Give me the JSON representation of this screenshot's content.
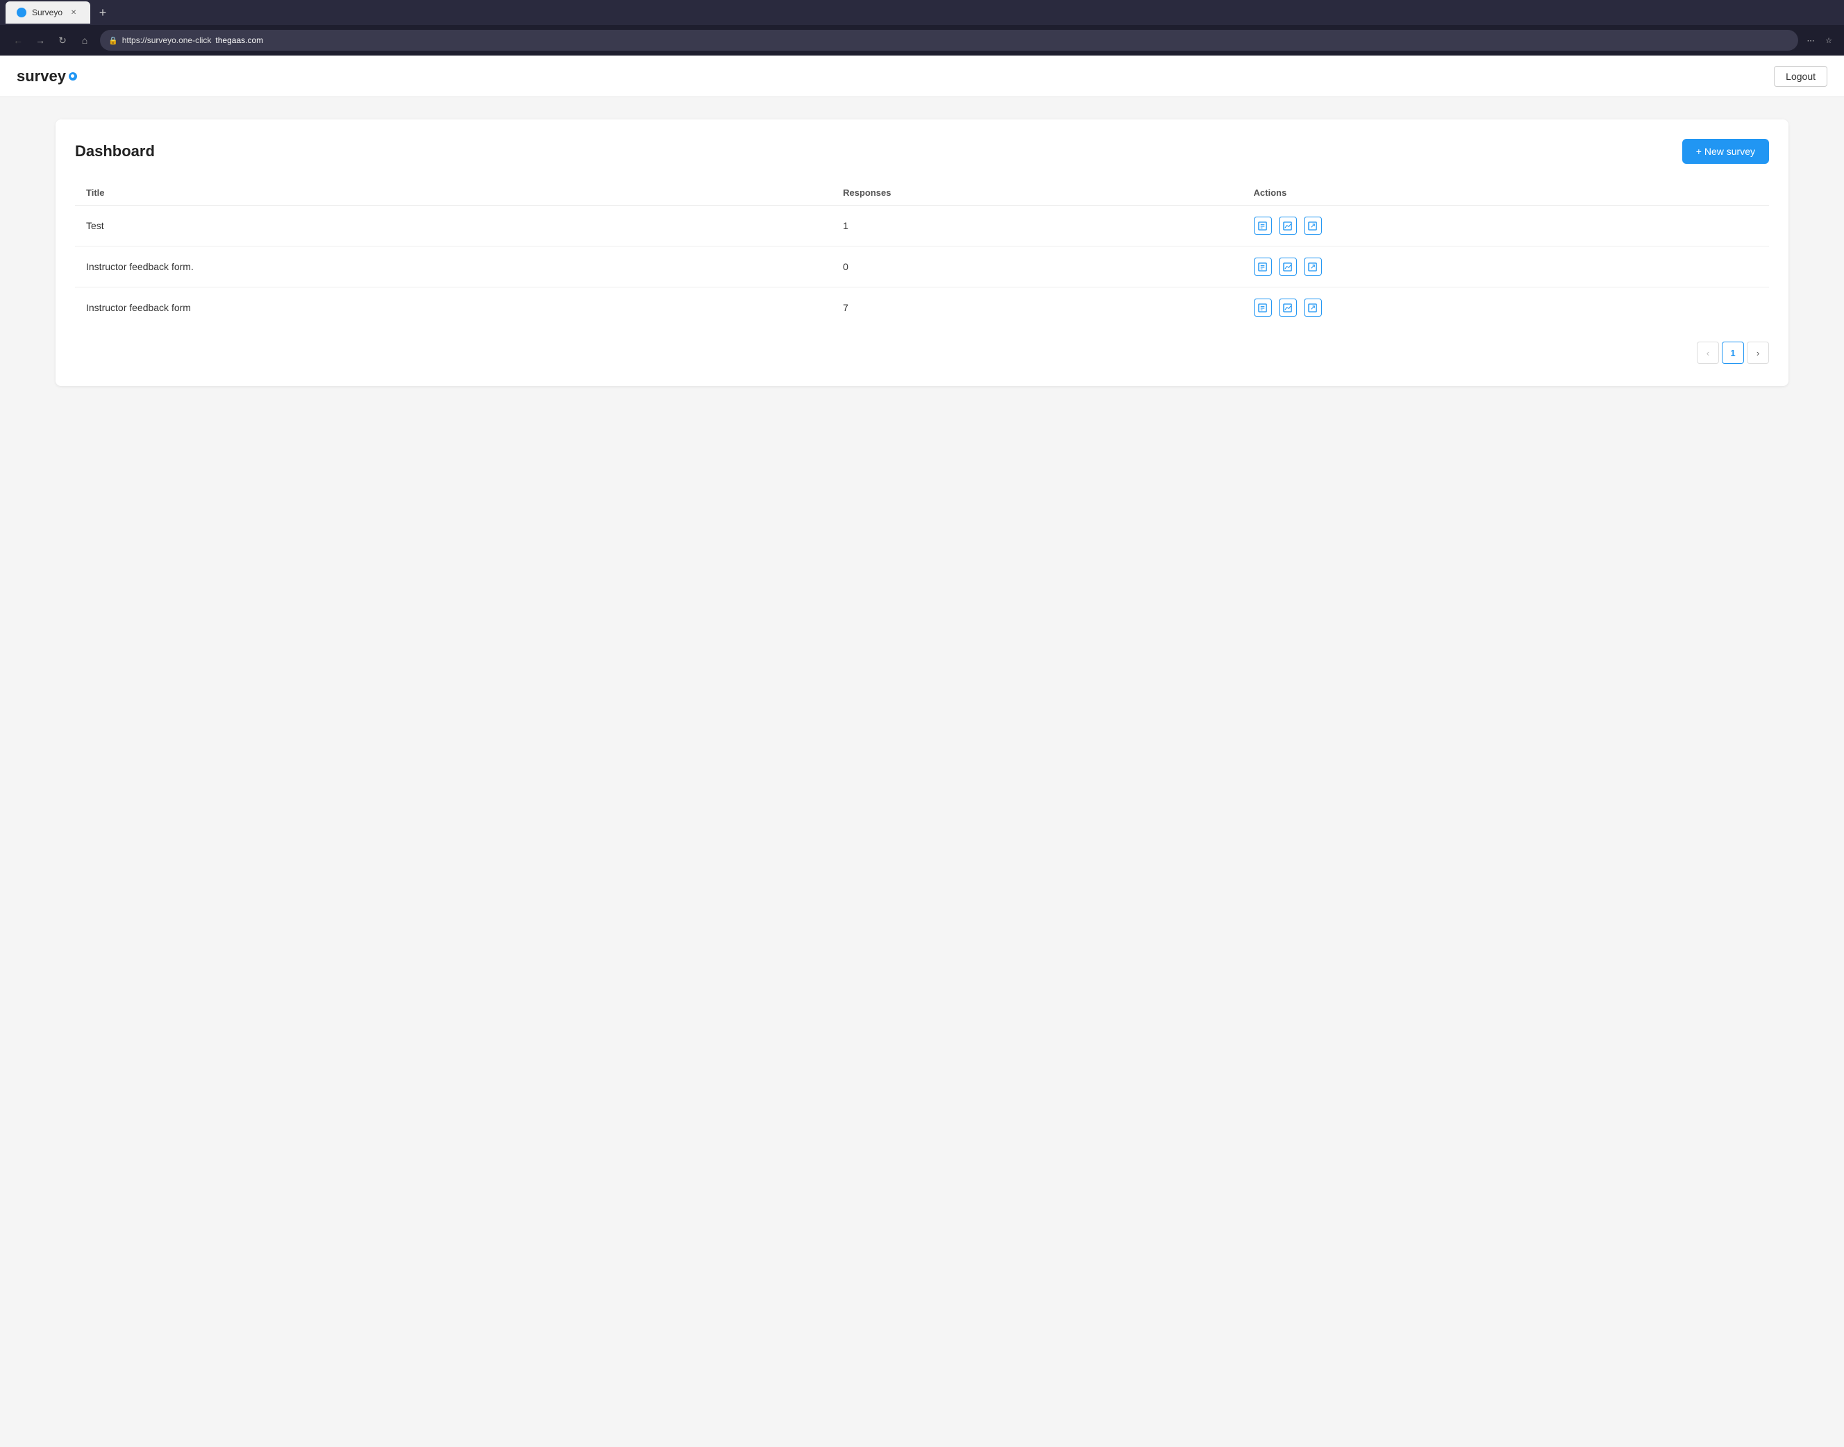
{
  "browser": {
    "tab_title": "Surveyo",
    "tab_favicon": "S",
    "url_prefix": "https://surveyo.one-click",
    "url_domain": "thegaas.com",
    "new_tab_icon": "+"
  },
  "header": {
    "logo_text": "survey",
    "logout_label": "Logout"
  },
  "dashboard": {
    "title": "Dashboard",
    "new_survey_label": "+ New survey",
    "table": {
      "columns": [
        "Title",
        "Responses",
        "Actions"
      ],
      "rows": [
        {
          "title": "Test",
          "responses": "1"
        },
        {
          "title": "Instructor feedback form.",
          "responses": "0"
        },
        {
          "title": "Instructor feedback form",
          "responses": "7"
        }
      ]
    },
    "pagination": {
      "prev_label": "‹",
      "next_label": "›",
      "current_page": "1"
    }
  },
  "icons": {
    "edit": "⊟",
    "chart": "↗",
    "share": "⊠"
  }
}
